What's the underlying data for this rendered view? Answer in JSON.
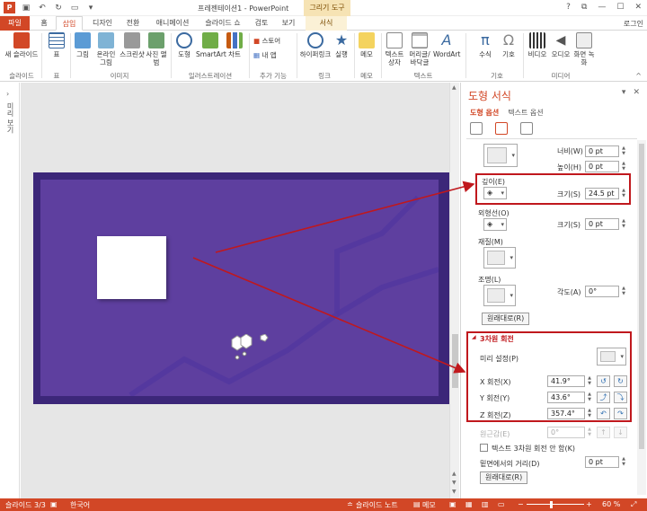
{
  "titlebar": {
    "app_badge": "P",
    "doc_title": "프레젠테이션1 - PowerPoint",
    "context_tool": "그리기 도구",
    "controls": [
      "?",
      "⧉",
      "—",
      "☐",
      "✕"
    ]
  },
  "tabs": {
    "file": "파일",
    "items": [
      "홈",
      "삽입",
      "디자인",
      "전환",
      "애니메이션",
      "슬라이드 쇼",
      "검토",
      "보기"
    ],
    "context_tab": "서식",
    "login": "로그인"
  },
  "ribbon": {
    "buttons": [
      "새 슬라이드",
      "표",
      "그림",
      "온라인 그림",
      "스크린샷",
      "사진 앨범",
      "도형",
      "SmartArt",
      "차트",
      "하이퍼링크",
      "실행",
      "메모",
      "텍스트 상자",
      "머리글/바닥글",
      "WordArt",
      "수식",
      "기호",
      "비디오",
      "오디오",
      "화면 녹화"
    ],
    "small_buttons": [
      "스토어",
      "내 앱"
    ],
    "groups": [
      "슬라이드",
      "표",
      "이미지",
      "일러스트레이션",
      "추가 기능",
      "링크",
      "메모",
      "텍스트",
      "기호",
      "미디어"
    ]
  },
  "leftpane": {
    "label": "미리 보기"
  },
  "pane": {
    "title": "도형 서식",
    "tabs": [
      "도형 옵션",
      "텍스트 옵션"
    ],
    "width_label": "너비(W)",
    "width_value": "0 pt",
    "height_label": "높이(H)",
    "height_value": "0 pt",
    "depth_label": "깊이(E)",
    "depth_size_label": "크기(S)",
    "depth_size_value": "24.5 pt",
    "contour_label": "외형선(O)",
    "contour_size_label": "크기(S)",
    "contour_size_value": "0 pt",
    "material_label": "재질(M)",
    "lighting_label": "조명(L)",
    "angle_label": "각도(A)",
    "angle_value": "0°",
    "reset_label": "원래대로(R)",
    "rotation_title": "3차원 회전",
    "preset_label": "미리 설정(P)",
    "x_label": "X 회전(X)",
    "x_value": "41.9°",
    "y_label": "Y 회전(Y)",
    "y_value": "43.6°",
    "z_label": "Z 회전(Z)",
    "z_value": "357.4°",
    "perspective_label": "원근감(E)",
    "perspective_value": "0°",
    "keep_text_flat_label": "텍스트 3차원 회전 안 함(K)",
    "distance_label": "밑면에서의 거리(D)",
    "distance_value": "0 pt",
    "reset2_label": "원래대로(R)"
  },
  "status": {
    "slide": "슬라이드 3/3",
    "language": "한국어",
    "notes": "슬라이드 노트",
    "comments": "메모",
    "zoom": "60 %"
  },
  "colors": {
    "accent": "#d24726",
    "slide_border": "#3c2779",
    "slide_fill": "#5e3f9f",
    "highlight": "#c0181d"
  }
}
